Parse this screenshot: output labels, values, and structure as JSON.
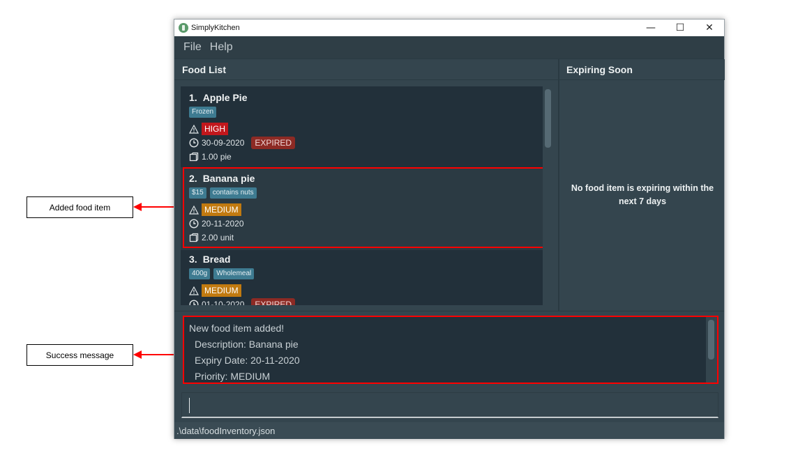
{
  "window": {
    "title": "SimplyKitchen",
    "controls": {
      "minimize": "—",
      "maximize": "☐",
      "close": "✕"
    }
  },
  "menu": {
    "items": [
      "File",
      "Help"
    ]
  },
  "food_list": {
    "header": "Food List",
    "items": [
      {
        "index": "1.",
        "name": "Apple Pie",
        "tags": [
          "Frozen"
        ],
        "priority": "HIGH",
        "expiry": "30-09-2020",
        "expired_label": "EXPIRED",
        "quantity": "1.00 pie"
      },
      {
        "index": "2.",
        "name": "Banana pie",
        "tags": [
          "$15",
          "contains nuts"
        ],
        "priority": "MEDIUM",
        "expiry": "20-11-2020",
        "expired_label": "",
        "quantity": "2.00 unit"
      },
      {
        "index": "3.",
        "name": "Bread",
        "tags": [
          "400g",
          "Wholemeal"
        ],
        "priority": "MEDIUM",
        "expiry": "01-10-2020",
        "expired_label": "EXPIRED",
        "quantity": ""
      }
    ]
  },
  "expiring_soon": {
    "header": "Expiring Soon",
    "empty_message": "No food item is expiring within the next 7 days"
  },
  "result_display": {
    "lines": [
      "New food item added!",
      "Description: Banana pie",
      "Expiry Date: 20-11-2020",
      "Priority: MEDIUM"
    ]
  },
  "command_box": {
    "value": ""
  },
  "status_bar": {
    "file_path": ".\\data\\foodInventory.json"
  },
  "annotations": {
    "added_item": "Added food item",
    "success": "Success message"
  },
  "colors": {
    "highlight": "#ff0000",
    "priority_high": "#c2171c",
    "priority_medium": "#c17a10",
    "expired": "#8d2a24",
    "tag": "#3e7b91"
  }
}
